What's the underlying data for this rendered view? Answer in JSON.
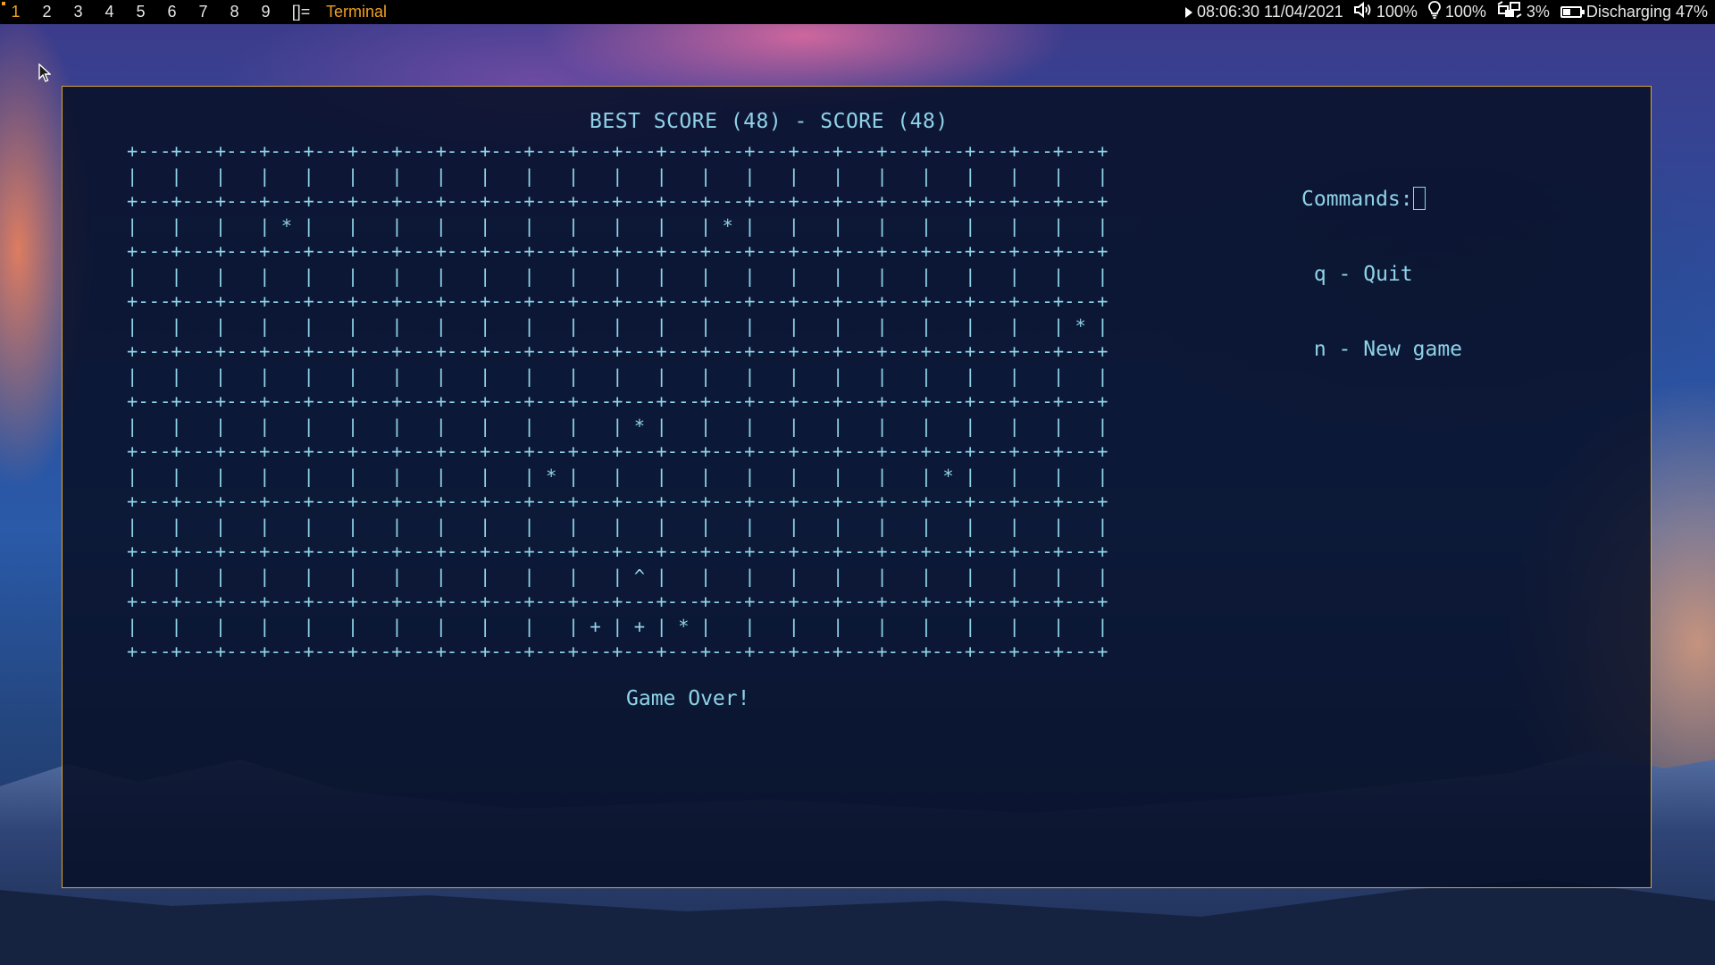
{
  "topbar": {
    "workspaces": [
      "1",
      "2",
      "3",
      "4",
      "5",
      "6",
      "7",
      "8",
      "9"
    ],
    "active_workspace": "1",
    "layout_symbol": "[]=",
    "window_title": "Terminal",
    "media_icon": "play-icon",
    "datetime": "08:06:30 11/04/2021",
    "volume_icon": "speaker-icon",
    "volume": "100%",
    "brightness_icon": "lightbulb-icon",
    "brightness": "100%",
    "cpu_icon": "cpu-chip-icon",
    "cpu": "3%",
    "battery_icon": "battery-icon",
    "battery_level": 0.47,
    "battery": "Discharging 47%"
  },
  "terminal": {
    "title": "BEST SCORE (48) - SCORE (48)",
    "board": {
      "cols": 22,
      "rows": [
        [
          "",
          "",
          "",
          "",
          "",
          "",
          "",
          "",
          "",
          "",
          "",
          "",
          "",
          "",
          "",
          "",
          "",
          "",
          "",
          "",
          "",
          ""
        ],
        [
          "",
          "",
          "",
          "*",
          "",
          "",
          "",
          "",
          "",
          "",
          "",
          "",
          "",
          "*",
          "",
          "",
          "",
          "",
          "",
          "",
          "",
          ""
        ],
        [
          "",
          "",
          "",
          "",
          "",
          "",
          "",
          "",
          "",
          "",
          "",
          "",
          "",
          "",
          "",
          "",
          "",
          "",
          "",
          "",
          "",
          ""
        ],
        [
          "",
          "",
          "",
          "",
          "",
          "",
          "",
          "",
          "",
          "",
          "",
          "",
          "",
          "",
          "",
          "",
          "",
          "",
          "",
          "",
          "",
          "*"
        ],
        [
          "",
          "",
          "",
          "",
          "",
          "",
          "",
          "",
          "",
          "",
          "",
          "",
          "",
          "",
          "",
          "",
          "",
          "",
          "",
          "",
          "",
          ""
        ],
        [
          "",
          "",
          "",
          "",
          "",
          "",
          "",
          "",
          "",
          "",
          "",
          "*",
          "",
          "",
          "",
          "",
          "",
          "",
          "",
          "",
          "",
          ""
        ],
        [
          "",
          "",
          "",
          "",
          "",
          "",
          "",
          "",
          "",
          "*",
          "",
          "",
          "",
          "",
          "",
          "",
          "",
          "",
          "*",
          "",
          "",
          ""
        ],
        [
          "",
          "",
          "",
          "",
          "",
          "",
          "",
          "",
          "",
          "",
          "",
          "",
          "",
          "",
          "",
          "",
          "",
          "",
          "",
          "",
          "",
          ""
        ],
        [
          "",
          "",
          "",
          "",
          "",
          "",
          "",
          "",
          "",
          "",
          "",
          "^",
          "",
          "",
          "",
          "",
          "",
          "",
          "",
          "",
          "",
          ""
        ],
        [
          "",
          "",
          "",
          "",
          "",
          "",
          "",
          "",
          "",
          "",
          "+",
          "+",
          "*",
          "",
          "",
          "",
          "",
          "",
          "",
          "",
          "",
          ""
        ]
      ]
    },
    "commands_label": "Commands:",
    "commands": [
      "q - Quit",
      "n - New game"
    ],
    "status": "Game Over!"
  },
  "colors": {
    "terminal_text": "#8fd3e8",
    "accent": "#f0a020",
    "window_border": "#d8a23a"
  }
}
